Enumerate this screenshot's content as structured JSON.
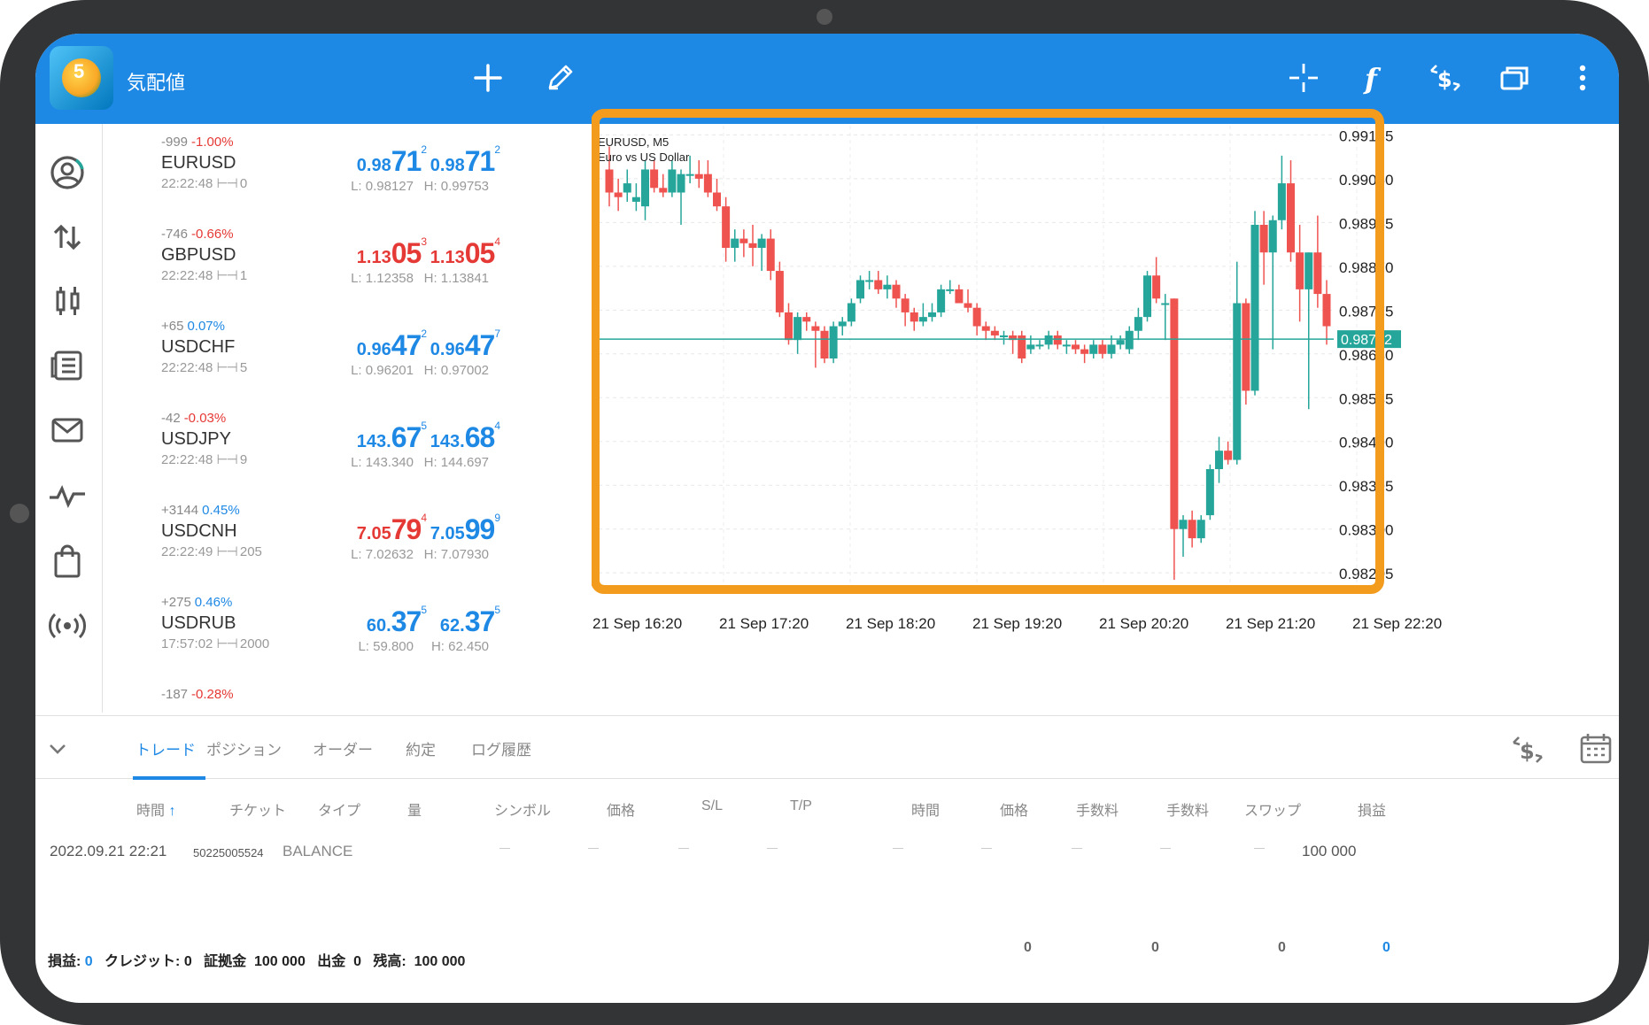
{
  "app": {
    "title": "気配値"
  },
  "toolbar_icons": [
    "add-icon",
    "pencil-icon",
    "crosshair-icon",
    "function-icon",
    "trade-dollar-icon",
    "windows-icon",
    "more-vert-icon"
  ],
  "nav_icons": [
    "account-icon",
    "trade-arrows-icon",
    "chart-candles-icon",
    "journal-icon",
    "mail-icon",
    "signal-icon",
    "shop-bag-icon",
    "broadcast-icon"
  ],
  "quotes": [
    {
      "points": "-999",
      "pct": "-1.00%",
      "pct_dir": "down",
      "symbol": "EURUSD",
      "time": "22:22:48",
      "spread": "0",
      "bid_a": "0.98",
      "bid_b": "71",
      "bid_c": "2",
      "ask_a": "0.98",
      "ask_b": "71",
      "ask_c": "2",
      "low": "L: 0.98127",
      "high": "H: 0.99753",
      "bid_color": "#1e88e5",
      "ask_color": "#1e88e5"
    },
    {
      "points": "-746",
      "pct": "-0.66%",
      "pct_dir": "down",
      "symbol": "GBPUSD",
      "time": "22:22:48",
      "spread": "1",
      "bid_a": "1.13",
      "bid_b": "05",
      "bid_c": "3",
      "ask_a": "1.13",
      "ask_b": "05",
      "ask_c": "4",
      "low": "L: 1.12358",
      "high": "H: 1.13841",
      "bid_color": "#e53935",
      "ask_color": "#e53935"
    },
    {
      "points": "+65",
      "pct": "0.07%",
      "pct_dir": "up",
      "symbol": "USDCHF",
      "time": "22:22:48",
      "spread": "5",
      "bid_a": "0.96",
      "bid_b": "47",
      "bid_c": "2",
      "ask_a": "0.96",
      "ask_b": "47",
      "ask_c": "7",
      "low": "L: 0.96201",
      "high": "H: 0.97002",
      "bid_color": "#1e88e5",
      "ask_color": "#1e88e5"
    },
    {
      "points": "-42",
      "pct": "-0.03%",
      "pct_dir": "down",
      "symbol": "USDJPY",
      "time": "22:22:48",
      "spread": "9",
      "bid_a": "143.",
      "bid_b": "67",
      "bid_c": "5",
      "ask_a": "143.",
      "ask_b": "68",
      "ask_c": "4",
      "low": "L: 143.340",
      "high": "H: 144.697",
      "bid_color": "#1e88e5",
      "ask_color": "#1e88e5"
    },
    {
      "points": "+3144",
      "pct": "0.45%",
      "pct_dir": "up",
      "symbol": "USDCNH",
      "time": "22:22:49",
      "spread": "205",
      "bid_a": "7.05",
      "bid_b": "79",
      "bid_c": "4",
      "ask_a": "7.05",
      "ask_b": "99",
      "ask_c": "9",
      "low": "L: 7.02632",
      "high": "H: 7.07930",
      "bid_color": "#e53935",
      "ask_color": "#1e88e5"
    },
    {
      "points": "+275",
      "pct": "0.46%",
      "pct_dir": "up",
      "symbol": "USDRUB",
      "time": "17:57:02",
      "spread": "2000",
      "bid_a": "60.",
      "bid_b": "37",
      "bid_c": "5",
      "ask_a": "62.",
      "ask_b": "37",
      "ask_c": "5",
      "low": "L: 59.800",
      "high": "H: 62.450",
      "bid_color": "#1e88e5",
      "ask_color": "#1e88e5"
    },
    {
      "points": "-187",
      "pct": "-0.28%",
      "pct_dir": "down",
      "symbol": "",
      "time": "",
      "spread": "",
      "bid_a": "",
      "bid_b": "",
      "bid_c": "",
      "ask_a": "",
      "ask_b": "",
      "ask_c": "",
      "low": "",
      "high": "",
      "bid_color": "#1e88e5",
      "ask_color": "#1e88e5"
    }
  ],
  "chart": {
    "label_symbol": "EURUSD, M5",
    "label_desc": "Euro vs US Dollar",
    "current_price": "0.98712",
    "y_ticks": [
      "0.99155",
      "0.99060",
      "0.98965",
      "0.98870",
      "0.98775",
      "0.98680",
      "0.98585",
      "0.98490",
      "0.98395",
      "0.98300",
      "0.98205"
    ],
    "x_ticks": [
      "21 Sep 16:20",
      "21 Sep 17:20",
      "21 Sep 18:20",
      "21 Sep 19:20",
      "21 Sep 20:20",
      "21 Sep 21:20",
      "21 Sep 22:20"
    ],
    "highlight_color": "#f29b1d",
    "up_color": "#26a69a",
    "down_color": "#ef5350"
  },
  "chart_data": {
    "type": "candlestick",
    "symbol": "EURUSD, M5",
    "title": "Euro vs US Dollar",
    "ylim": [
      0.98165,
      0.99175
    ],
    "current": 0.98712,
    "candles": [
      [
        0.9908,
        0.9913,
        0.99,
        0.9903
      ],
      [
        0.9903,
        0.9906,
        0.9899,
        0.9902
      ],
      [
        0.9903,
        0.9908,
        0.9901,
        0.9905
      ],
      [
        0.9901,
        0.9905,
        0.9899,
        0.9902
      ],
      [
        0.99,
        0.991,
        0.9897,
        0.9908
      ],
      [
        0.9908,
        0.991,
        0.9903,
        0.9904
      ],
      [
        0.9904,
        0.9907,
        0.9902,
        0.9903
      ],
      [
        0.9903,
        0.991,
        0.9902,
        0.9908
      ],
      [
        0.9903,
        0.9908,
        0.9896,
        0.9907
      ],
      [
        0.9907,
        0.9911,
        0.9905,
        0.9907
      ],
      [
        0.9907,
        0.991,
        0.9904,
        0.9906
      ],
      [
        0.9907,
        0.991,
        0.9902,
        0.9903
      ],
      [
        0.9903,
        0.9906,
        0.9899,
        0.99
      ],
      [
        0.99,
        0.9902,
        0.9888,
        0.9891
      ],
      [
        0.9891,
        0.9895,
        0.9888,
        0.9893
      ],
      [
        0.9893,
        0.9895,
        0.9889,
        0.9892
      ],
      [
        0.9892,
        0.9896,
        0.9887,
        0.9891
      ],
      [
        0.9891,
        0.9894,
        0.9886,
        0.9893
      ],
      [
        0.9893,
        0.9895,
        0.9884,
        0.9886
      ],
      [
        0.9886,
        0.9888,
        0.9876,
        0.9877
      ],
      [
        0.9877,
        0.9879,
        0.987,
        0.9871
      ],
      [
        0.9871,
        0.9877,
        0.9868,
        0.9876
      ],
      [
        0.9876,
        0.9877,
        0.9873,
        0.9875
      ],
      [
        0.9874,
        0.9875,
        0.9865,
        0.9873
      ],
      [
        0.9873,
        0.9874,
        0.9866,
        0.9867
      ],
      [
        0.9867,
        0.9875,
        0.9866,
        0.9874
      ],
      [
        0.9874,
        0.9876,
        0.9872,
        0.9875
      ],
      [
        0.9875,
        0.988,
        0.9874,
        0.9879
      ],
      [
        0.988,
        0.9885,
        0.9879,
        0.9884
      ],
      [
        0.9884,
        0.9886,
        0.9882,
        0.9884
      ],
      [
        0.9884,
        0.9886,
        0.9881,
        0.9882
      ],
      [
        0.9882,
        0.9885,
        0.988,
        0.9883
      ],
      [
        0.9883,
        0.9884,
        0.9878,
        0.988
      ],
      [
        0.988,
        0.9881,
        0.9874,
        0.9877
      ],
      [
        0.9877,
        0.9878,
        0.9873,
        0.9875
      ],
      [
        0.9875,
        0.9879,
        0.9874,
        0.9876
      ],
      [
        0.9876,
        0.9879,
        0.9875,
        0.9877
      ],
      [
        0.9877,
        0.9883,
        0.9876,
        0.9882
      ],
      [
        0.9882,
        0.9884,
        0.9881,
        0.9882
      ],
      [
        0.9882,
        0.9883,
        0.9879,
        0.9879
      ],
      [
        0.9879,
        0.9882,
        0.9877,
        0.9878
      ],
      [
        0.9878,
        0.9879,
        0.9872,
        0.9874
      ],
      [
        0.9874,
        0.9875,
        0.9871,
        0.9873
      ],
      [
        0.9873,
        0.9874,
        0.9871,
        0.9872
      ],
      [
        0.9872,
        0.9873,
        0.987,
        0.9872
      ],
      [
        0.9872,
        0.9873,
        0.9868,
        0.9871
      ],
      [
        0.9872,
        0.9873,
        0.9866,
        0.9867
      ],
      [
        0.9869,
        0.9872,
        0.9868,
        0.987
      ],
      [
        0.987,
        0.9871,
        0.9869,
        0.987
      ],
      [
        0.987,
        0.9873,
        0.9869,
        0.9872
      ],
      [
        0.9872,
        0.9873,
        0.9869,
        0.987
      ],
      [
        0.987,
        0.9871,
        0.9868,
        0.987
      ],
      [
        0.987,
        0.9871,
        0.9868,
        0.9869
      ],
      [
        0.9869,
        0.987,
        0.9866,
        0.9868
      ],
      [
        0.9868,
        0.9871,
        0.9867,
        0.987
      ],
      [
        0.987,
        0.9871,
        0.9867,
        0.9868
      ],
      [
        0.9868,
        0.9872,
        0.9867,
        0.987
      ],
      [
        0.987,
        0.9872,
        0.9869,
        0.9871
      ],
      [
        0.9869,
        0.9874,
        0.9868,
        0.9873
      ],
      [
        0.9873,
        0.9878,
        0.9871,
        0.9876
      ],
      [
        0.9876,
        0.9886,
        0.9875,
        0.9885
      ],
      [
        0.9885,
        0.9889,
        0.9879,
        0.988
      ],
      [
        0.9879,
        0.9881,
        0.9871,
        0.9879
      ],
      [
        0.988,
        0.988,
        0.9819,
        0.983
      ],
      [
        0.983,
        0.9833,
        0.9824,
        0.9832
      ],
      [
        0.9832,
        0.9834,
        0.9826,
        0.9828
      ],
      [
        0.9828,
        0.9833,
        0.9827,
        0.9832
      ],
      [
        0.9833,
        0.9844,
        0.9832,
        0.9843
      ],
      [
        0.9843,
        0.985,
        0.984,
        0.9847
      ],
      [
        0.9847,
        0.9849,
        0.9844,
        0.9845
      ],
      [
        0.9845,
        0.9888,
        0.9844,
        0.9879
      ],
      [
        0.9879,
        0.988,
        0.9857,
        0.986
      ],
      [
        0.986,
        0.9899,
        0.9859,
        0.9896
      ],
      [
        0.9896,
        0.9899,
        0.9883,
        0.989
      ],
      [
        0.989,
        0.9898,
        0.9869,
        0.9897
      ],
      [
        0.9897,
        0.9911,
        0.9895,
        0.9905
      ],
      [
        0.9905,
        0.991,
        0.9888,
        0.989
      ],
      [
        0.989,
        0.9896,
        0.9875,
        0.9882
      ],
      [
        0.9882,
        0.989,
        0.9856,
        0.989
      ],
      [
        0.989,
        0.9898,
        0.9878,
        0.9881
      ],
      [
        0.9881,
        0.9884,
        0.987,
        0.9874
      ]
    ]
  },
  "bottom": {
    "tabs": [
      "トレード",
      "ポジション",
      "オーダー",
      "約定",
      "ログ履歴"
    ],
    "columns": [
      "時間",
      "チケット",
      "タイプ",
      "量",
      "シンボル",
      "価格",
      "S/L",
      "T/P",
      "時間",
      "価格",
      "手数料",
      "手数料",
      "スワップ",
      "損益"
    ],
    "row": {
      "time": "2022.09.21 22:21",
      "ticket": "50225005524",
      "type": "BALANCE",
      "profit": "100 000"
    },
    "summary": {
      "pl_label": "損益:",
      "pl": "0",
      "credit_label": "クレジット:",
      "credit": "0",
      "margin_label": "証拠金",
      "margin": "100 000",
      "withdraw_label": "出金",
      "withdraw": "0",
      "balance_label": "残高:",
      "balance": "100 000"
    },
    "totals": [
      "0",
      "0",
      "0",
      "0"
    ]
  }
}
